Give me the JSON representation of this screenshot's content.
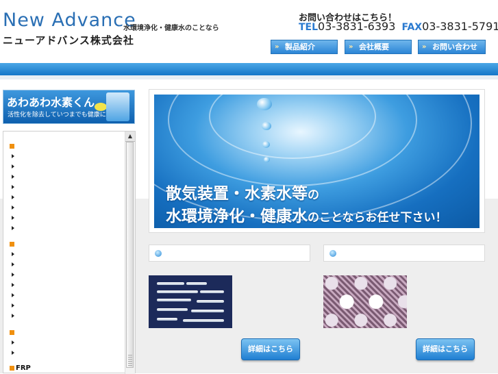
{
  "header": {
    "logo_en": "New Advance",
    "tagline": "水環境浄化・健康水のことなら",
    "company": "ニューアドバンス株式会社",
    "contact_heading": "お問い合わせはこちら！",
    "tel_label": "TEL",
    "tel": "03-3831-6393",
    "fax_label": "FAX",
    "fax": "03-3831-5791"
  },
  "nav": {
    "items": [
      {
        "label": "製品紹介"
      },
      {
        "label": "会社概要"
      },
      {
        "label": "お問い合わせ"
      }
    ],
    "arrow": "»"
  },
  "banner": {
    "title": "あわあわ水素くん",
    "subtitle": "活性化を除去していつまでも健康に"
  },
  "sidebar": {
    "frp_label": "FRP",
    "scroll_up": "▲"
  },
  "hero": {
    "line1_big": "散気装置・水素水等",
    "line1_small": "の",
    "line2_big": "水環境浄化・健康水",
    "line2_small": "のことならお任せ下さい！"
  },
  "cards": [
    {
      "title": "",
      "detail_label": "詳細はこちら"
    },
    {
      "title": "",
      "detail_label": "詳細はこちら"
    }
  ],
  "colors": {
    "brand_blue": "#2a6fb4",
    "nav_blue": "#2b85d6",
    "accent_orange": "#f0900f"
  }
}
